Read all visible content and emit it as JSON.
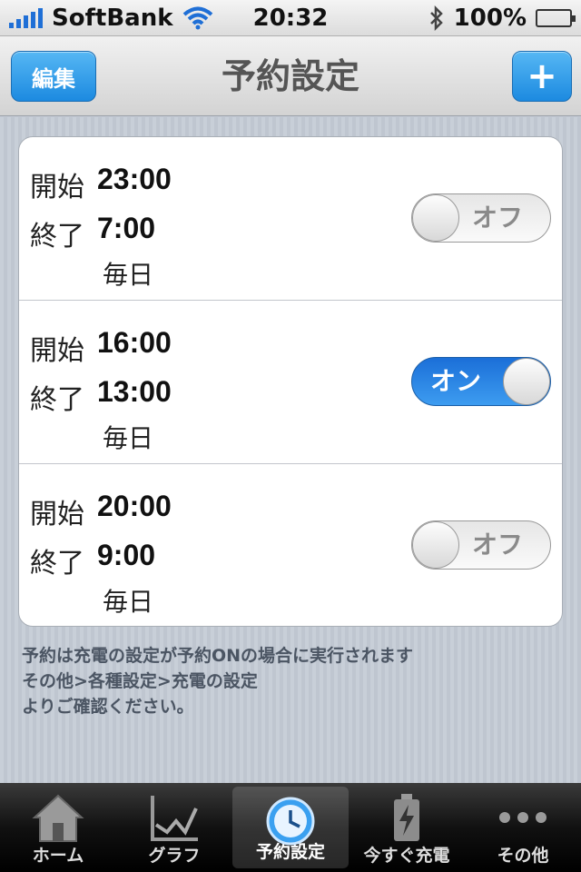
{
  "status_bar": {
    "carrier": "SoftBank",
    "time": "20:32",
    "battery": "100%"
  },
  "nav": {
    "title": "予約設定",
    "edit_label": "編集",
    "add_label": "+"
  },
  "schedules": [
    {
      "start_label": "開始",
      "start_time": "23:00",
      "end_label": "終了",
      "end_time": "7:00",
      "repeat": "毎日",
      "toggle": "オフ",
      "enabled": false
    },
    {
      "start_label": "開始",
      "start_time": "16:00",
      "end_label": "終了",
      "end_time": "13:00",
      "repeat": "毎日",
      "toggle": "オン",
      "enabled": true
    },
    {
      "start_label": "開始",
      "start_time": "20:00",
      "end_label": "終了",
      "end_time": "9:00",
      "repeat": "毎日",
      "toggle": "オフ",
      "enabled": false
    }
  ],
  "note": {
    "line1": "予約は充電の設定が予約ONの場合に実行されます",
    "line2": "その他>各種設定>充電の設定",
    "line3": "よりご確認ください。"
  },
  "tabs": [
    {
      "label": "ホーム",
      "icon": "home-icon"
    },
    {
      "label": "グラフ",
      "icon": "graph-icon"
    },
    {
      "label": "予約設定",
      "icon": "clock-icon",
      "active": true
    },
    {
      "label": "今すぐ充電",
      "icon": "battery-charge-icon"
    },
    {
      "label": "その他",
      "icon": "more-icon"
    }
  ],
  "colors": {
    "accent": "#1c8ae0",
    "toggle_on": "#2a86e6",
    "battery": "#3ec43e"
  }
}
